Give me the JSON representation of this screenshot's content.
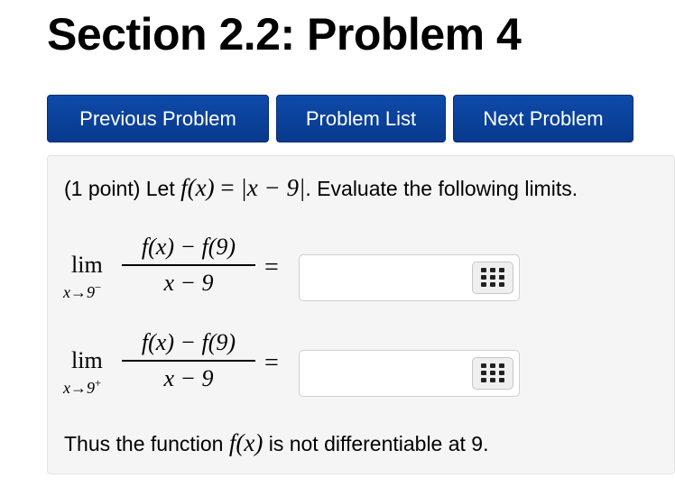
{
  "page": {
    "title": "Section 2.2: Problem 4"
  },
  "nav": {
    "previous_label": "Previous Problem",
    "list_label": "Problem List",
    "next_label": "Next Problem"
  },
  "problem": {
    "intro_prefix": "(1 point) Let ",
    "func_lhs": "f(x)",
    "equals": " = ",
    "func_rhs": "|x − 9|",
    "intro_suffix": ". Evaluate the following limits.",
    "limits": [
      {
        "lim_word": "lim",
        "approach": "x→9",
        "side": "−",
        "numerator": "f(x) − f(9)",
        "denominator": "x − 9",
        "eq_sign": "=",
        "answer_value": ""
      },
      {
        "lim_word": "lim",
        "approach": "x→9",
        "side": "+",
        "numerator": "f(x) − f(9)",
        "denominator": "x − 9",
        "eq_sign": "=",
        "answer_value": ""
      }
    ],
    "outro_prefix": "Thus the function ",
    "outro_func": "f(x)",
    "outro_suffix": " is not differentiable at 9."
  },
  "icons": {
    "math_keyboard": "math-keyboard-icon"
  },
  "colors": {
    "nav_button": "#0a43a0",
    "panel_bg": "#f5f5f5"
  }
}
